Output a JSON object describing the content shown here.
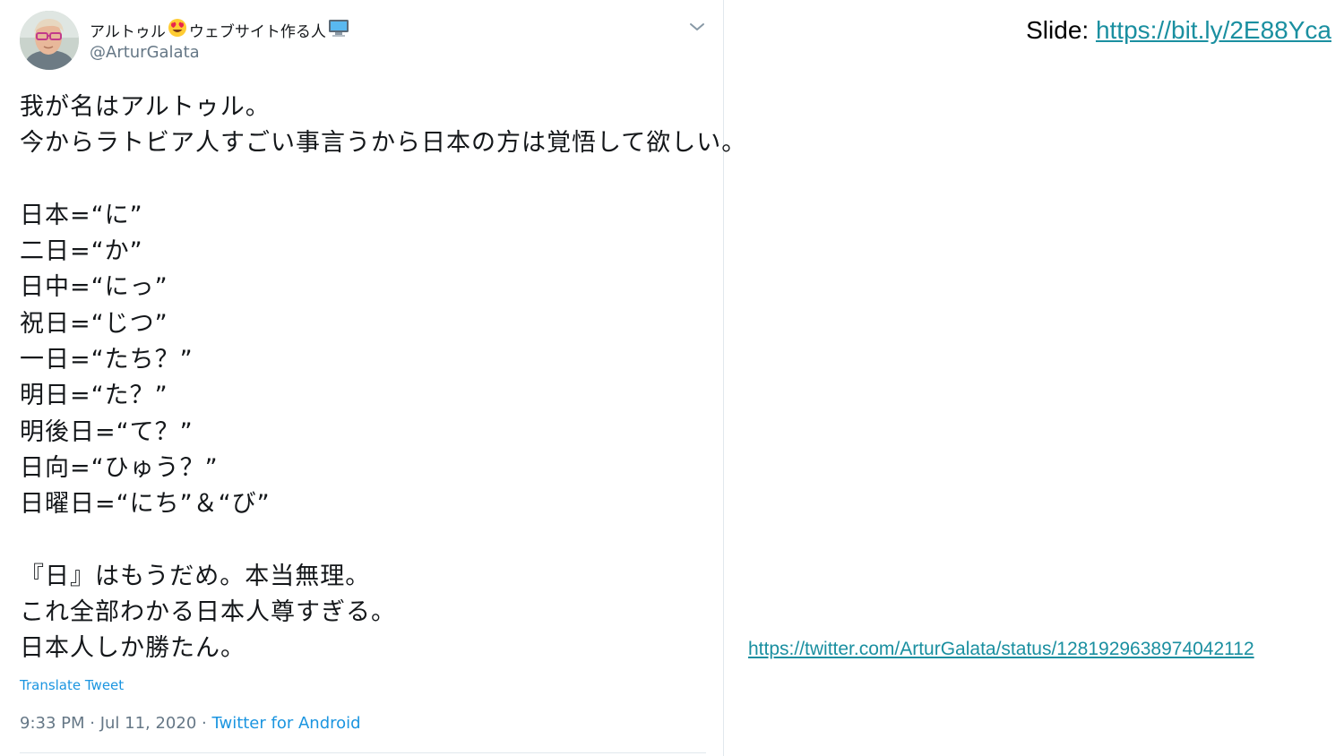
{
  "tweet": {
    "display_name": "アルトゥル",
    "display_name_suffix": "ウェブサイト作る人",
    "username": "@ArturGalata",
    "lines": [
      "我が名はアルトゥル。",
      "今からラトビア人すごい事言うから日本の方は覚悟して欲しい。",
      "",
      "日本=“に”",
      "二日=“か”",
      "日中=“にっ”",
      "祝日=“じつ”",
      "一日=“たち？”",
      "明日=“た？”",
      "明後日=“て？”",
      "日向=“ひゅう？”",
      "日曜日=“にち”＆“び”",
      "",
      "『日』はもうだめ。本当無理。",
      "これ全部わかる日本人尊すぎる。",
      "日本人しか勝たん。"
    ],
    "translate_label": "Translate Tweet",
    "timestamp": "9:33 PM · Jul 11, 2020 · ",
    "source": "Twitter for Android"
  },
  "slide": {
    "prefix": "Slide: ",
    "link_text": "https://bit.ly/2E88Yca"
  },
  "tweet_link": "https://twitter.com/ArturGalata/status/1281929638974042112",
  "icons": {
    "emoji_1": "heart-eyes-emoji-icon",
    "emoji_2": "computer-emoji-icon",
    "menu": "chevron-down-icon"
  },
  "colors": {
    "link_blue": "#1b95e0",
    "slide_link": "#1a8fa0",
    "text": "#14171a",
    "muted": "#657786"
  }
}
